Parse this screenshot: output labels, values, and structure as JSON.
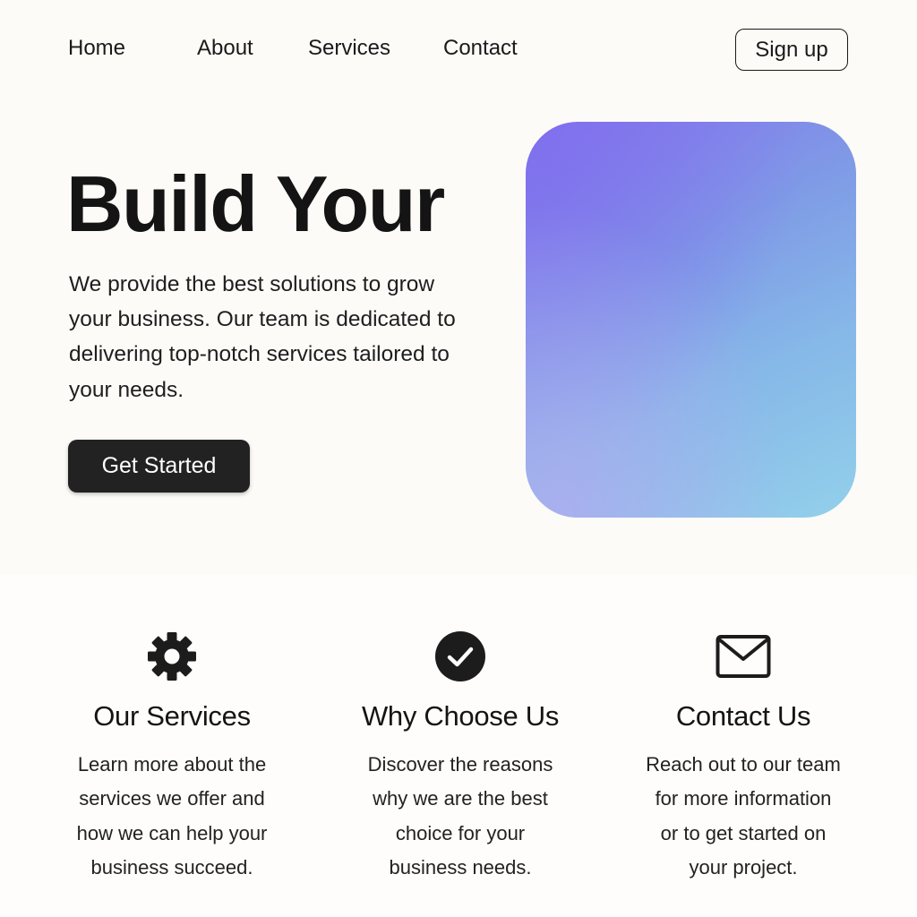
{
  "nav": {
    "links": [
      "Home",
      "About",
      "Services",
      "Contact"
    ],
    "signup_label": "Sign up"
  },
  "hero": {
    "title": "Build Your",
    "description": "We provide the best solutions to grow your business. Our team is dedicated to delivering top-notch services tailored to your needs.",
    "cta_label": "Get Started"
  },
  "features": [
    {
      "icon": "gear-icon",
      "title": "Our Services",
      "text": "Learn more about the\nservices we offer  and\nhow we can help your\nbusiness succeed."
    },
    {
      "icon": "check-circle-icon",
      "title": "Why Choose Us",
      "text": "Discover the reasons\nwhy we are the best\nchoice for your\nbusiness needs."
    },
    {
      "icon": "envelope-icon",
      "title": "Contact Us",
      "text": "Reach out to our team\nfor more information\nor to get started on\nyour project."
    }
  ],
  "colors": {
    "background": "#fcfbf8",
    "text": "#1a1a1a",
    "cta_background": "#222222",
    "gradient_start": "#8478ec",
    "gradient_end": "#93d0ea"
  }
}
